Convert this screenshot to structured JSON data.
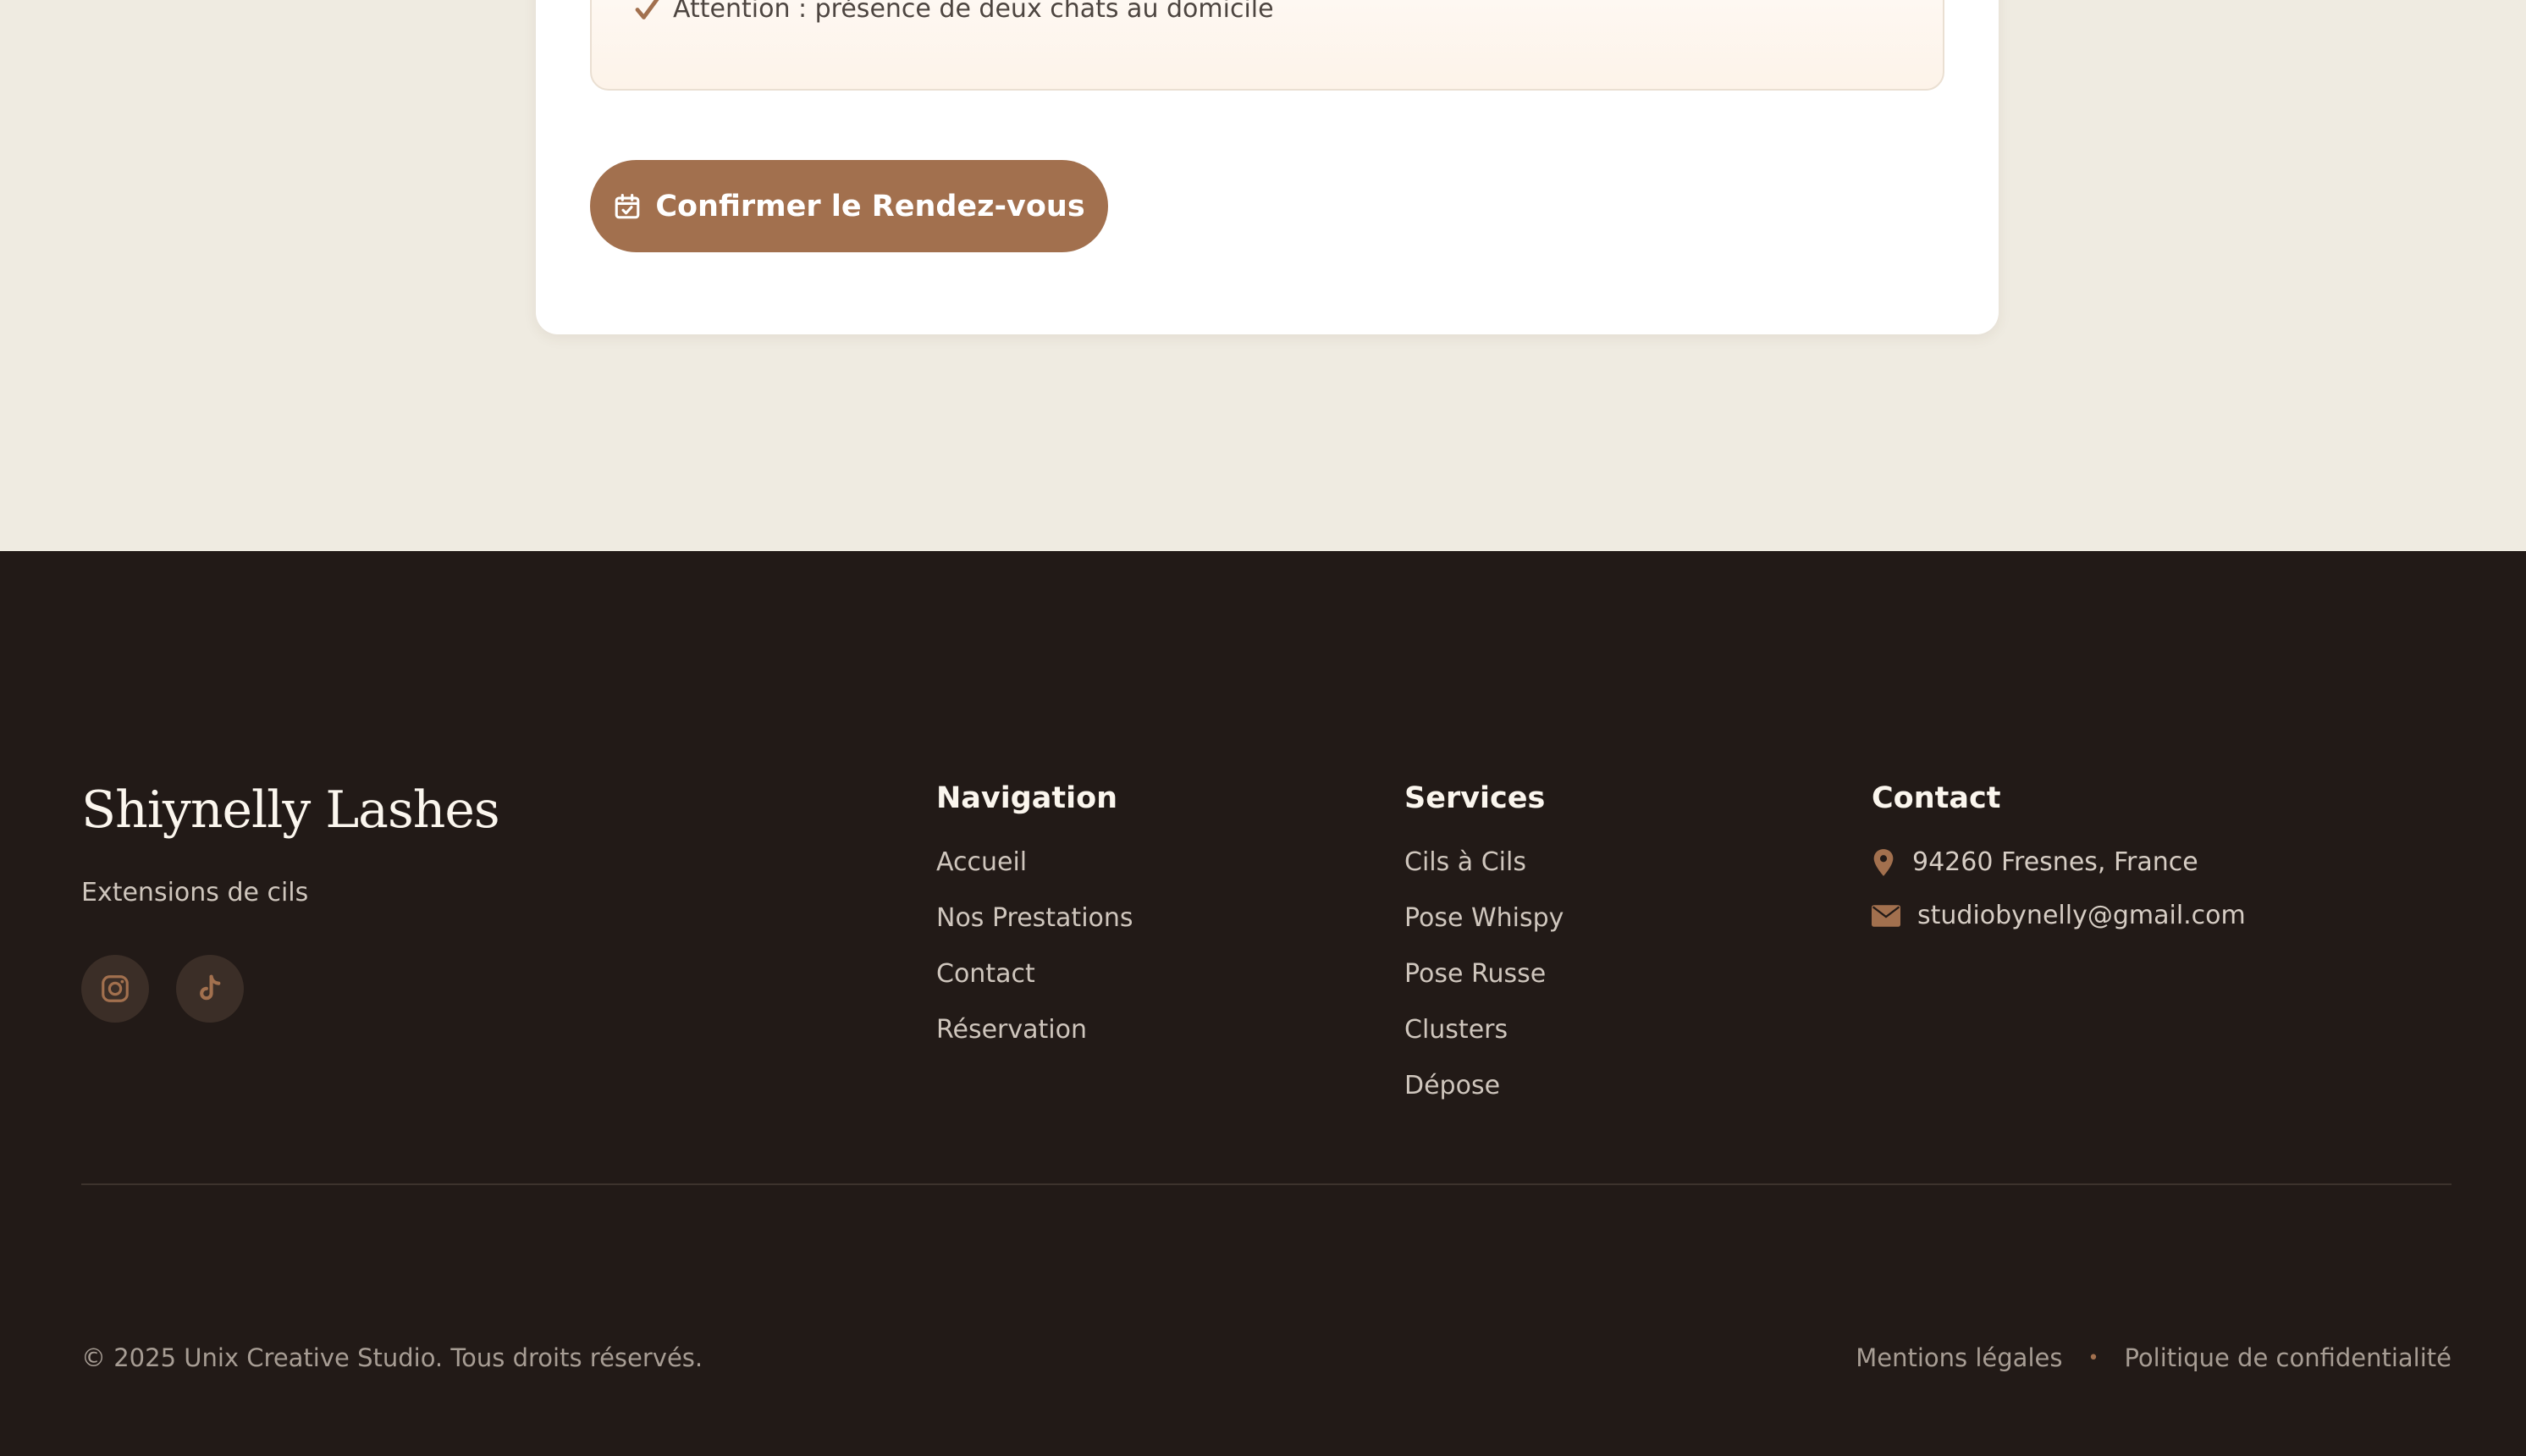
{
  "notice": {
    "item_text": "Attention : présence de deux chats au domicile",
    "icon": "check-icon"
  },
  "booking": {
    "confirm_label": "Confirmer le Rendez-vous",
    "confirm_icon": "calendar-check-icon"
  },
  "footer": {
    "brand": "Shiynelly Lashes",
    "tagline": "Extensions de cils",
    "social": [
      {
        "name": "instagram-icon"
      },
      {
        "name": "tiktok-icon"
      }
    ],
    "navigation": {
      "title": "Navigation",
      "items": [
        "Accueil",
        "Nos Prestations",
        "Contact",
        "Réservation"
      ]
    },
    "services": {
      "title": "Services",
      "items": [
        "Cils à Cils",
        "Pose Whispy",
        "Pose Russe",
        "Clusters",
        "Dépose"
      ]
    },
    "contact": {
      "title": "Contact",
      "address": "94260 Fresnes, France",
      "email": "studiobynelly@gmail.com"
    },
    "copyright": "© 2025 Unix Creative Studio. Tous droits réservés.",
    "legal": {
      "mentions": "Mentions légales",
      "separator": "•",
      "privacy": "Politique de confidentialité"
    }
  },
  "colors": {
    "accent": "#a2704e",
    "page_bg": "#efebe1",
    "footer_bg": "#221a17"
  }
}
